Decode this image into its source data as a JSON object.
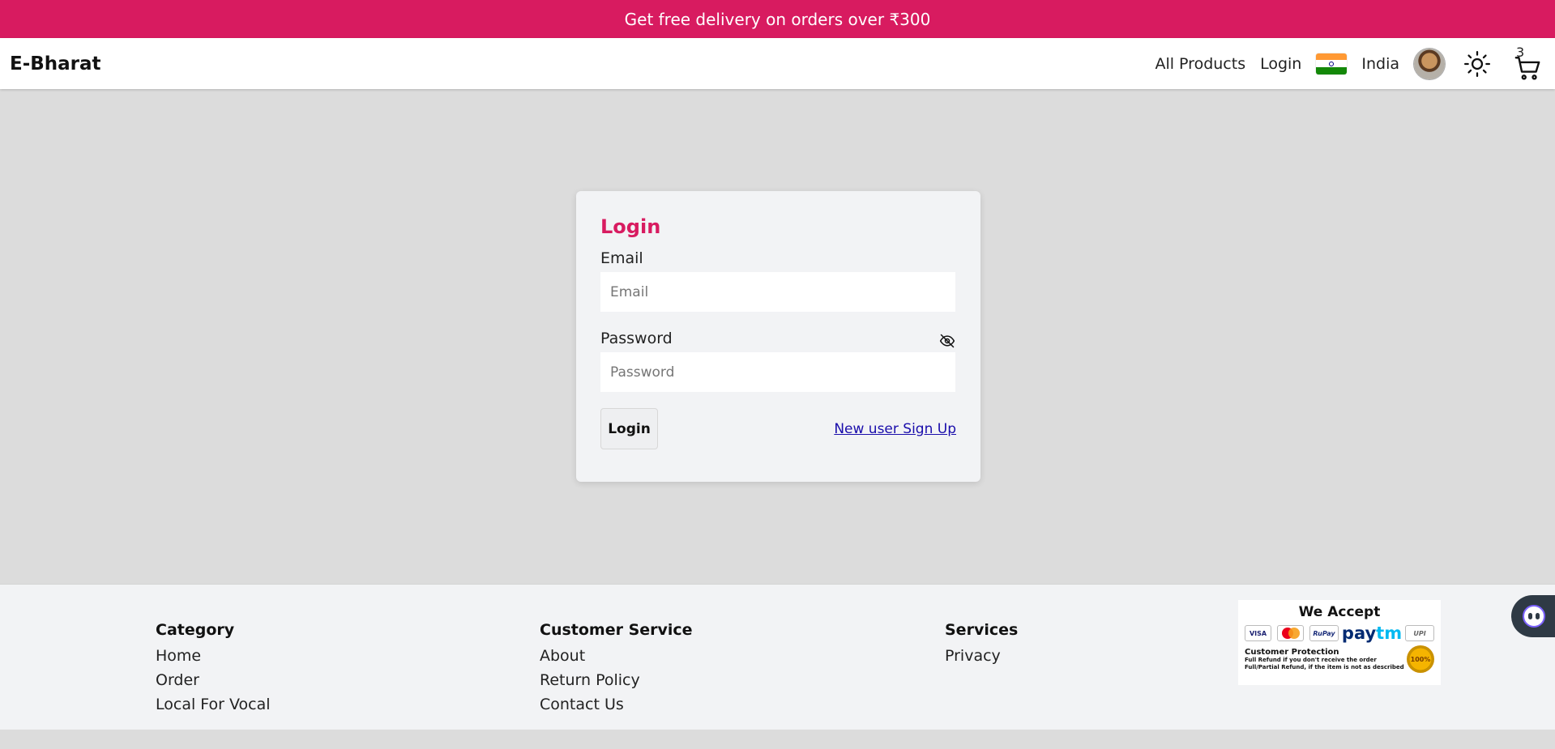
{
  "promo": {
    "text": "Get free delivery on orders over ₹300"
  },
  "navbar": {
    "brand": "E-Bharat",
    "links": {
      "all_products": "All Products",
      "login": "Login"
    },
    "country": "India",
    "cart_count": "3",
    "icons": {
      "flag": "india-flag-icon",
      "avatar": "user-avatar",
      "theme": "sun-icon",
      "cart": "cart-icon"
    }
  },
  "login": {
    "title": "Login",
    "email_label": "Email",
    "email_placeholder": "Email",
    "password_label": "Password",
    "password_placeholder": "Password",
    "submit_label": "Login",
    "signup_link": "New user Sign Up",
    "title_color": "#d81b60"
  },
  "footer": {
    "category": {
      "heading": "Category",
      "items": [
        "Home",
        "Order",
        "Local For Vocal"
      ]
    },
    "customer_service": {
      "heading": "Customer Service",
      "items": [
        "About",
        "Return Policy",
        "Contact Us"
      ]
    },
    "services": {
      "heading": "Services",
      "items": [
        "Privacy"
      ]
    },
    "we_accept": {
      "title": "We Accept",
      "cards": [
        "VISA",
        "MasterCard",
        "RuPay",
        "Paytm",
        "UPI"
      ],
      "paytm_pay": "pay",
      "paytm_tm": "tm",
      "protection_title": "Customer Protection",
      "protection_line1": "Full Refund if you don't receive the order",
      "protection_line2": "Full/Partial Refund, if the item is not as described",
      "badge": "100%"
    }
  },
  "colors": {
    "brand_pink": "#d81b60",
    "link_blue": "#1a0dab",
    "page_bg": "#dcdcdc"
  }
}
